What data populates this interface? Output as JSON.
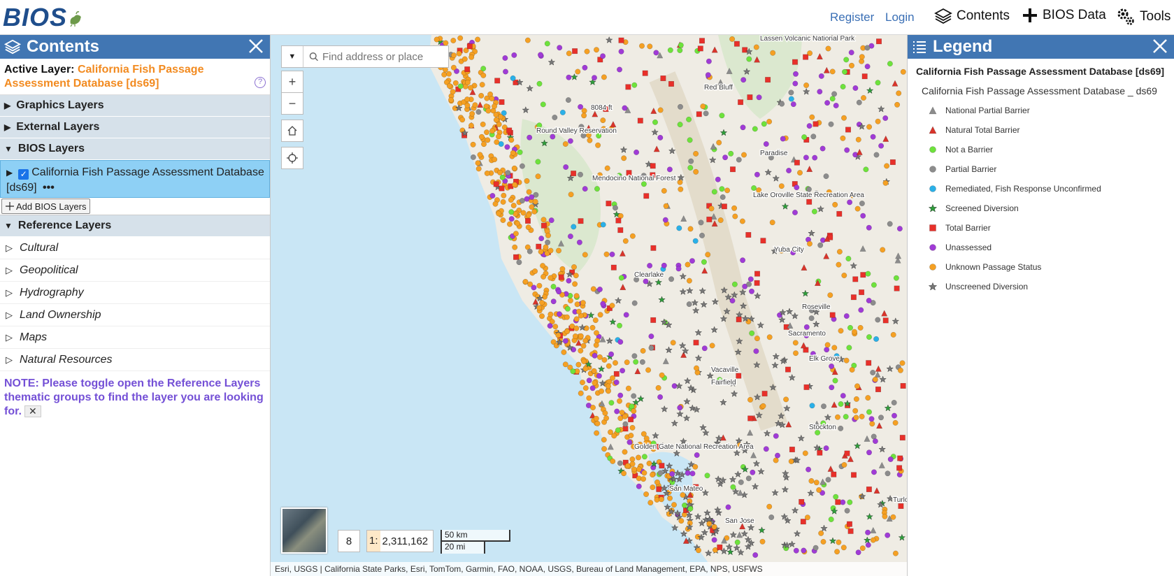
{
  "header": {
    "logo": "BIOS",
    "register": "Register",
    "login": "Login",
    "contents": "Contents",
    "bios_data": "BIOS Data",
    "tools": "Tools"
  },
  "contents_panel": {
    "title": "Contents",
    "active_layer_label": "Active Layer:",
    "active_layer_value": "California Fish Passage Assessment Database [ds69]",
    "groups": {
      "graphics": "Graphics Layers",
      "external": "External Layers",
      "bios": "BIOS Layers",
      "reference": "Reference Layers"
    },
    "bios_layer": {
      "name": "California Fish Passage Assessment Database [ds69]",
      "checked": true,
      "more": "•••"
    },
    "add_bios_layers": "Add BIOS Layers",
    "reference_items": [
      "Cultural",
      "Geopolitical",
      "Hydrography",
      "Land Ownership",
      "Maps",
      "Natural Resources"
    ],
    "note": "NOTE: Please toggle open the Reference Layers thematic groups to find the layer you are looking for."
  },
  "map": {
    "search_placeholder": "Find address or place",
    "zoom_level": "8",
    "scale_prefix": "1:",
    "scale_value": "2,311,162",
    "scalebar_km": "50 km",
    "scalebar_mi": "20 mi",
    "attribution": "Esri, USGS | California State Parks, Esri, TomTom, Garmin, FAO, NOAA, USGS, Bureau of Land Management, EPA, NPS, USFWS",
    "place_labels": [
      "Lassen Volcanic National Park",
      "Red Bluff",
      "Paradise",
      "Lake Oroville State Recreation Area",
      "Round Valley Reservation",
      "Mendocino National Forest",
      "Clearlake",
      "Yuba City",
      "Sacramento",
      "Elk Grove",
      "Vacaville",
      "Fairfield",
      "Golden Gate National Recreation Area",
      "San Mateo",
      "San Jose",
      "Stockton",
      "Turlock",
      "Roseville",
      "8084 ft"
    ]
  },
  "legend_panel": {
    "title": "Legend",
    "layer_title": "California Fish Passage Assessment Database [ds69]",
    "sublayer_title": "California Fish Passage Assessment Database _ ds69",
    "items": [
      {
        "label": "National Partial Barrier",
        "shape": "triangle",
        "color": "#8c8c8c"
      },
      {
        "label": "Natural Total Barrier",
        "shape": "triangle",
        "color": "#d9342b"
      },
      {
        "label": "Not a Barrier",
        "shape": "circle",
        "color": "#6ee23c"
      },
      {
        "label": "Partial Barrier",
        "shape": "circle",
        "color": "#8c8c8c"
      },
      {
        "label": "Remediated, Fish Response Unconfirmed",
        "shape": "circle",
        "color": "#2ab0e8"
      },
      {
        "label": "Screened Diversion",
        "shape": "star",
        "color": "#2e9e3a"
      },
      {
        "label": "Total Barrier",
        "shape": "square",
        "color": "#e8302a"
      },
      {
        "label": "Unassessed",
        "shape": "circle",
        "color": "#a03bd6"
      },
      {
        "label": "Unknown Passage Status",
        "shape": "circle",
        "color": "#f5a023"
      },
      {
        "label": "Unscreened Diversion",
        "shape": "star",
        "color": "#777777"
      }
    ]
  }
}
